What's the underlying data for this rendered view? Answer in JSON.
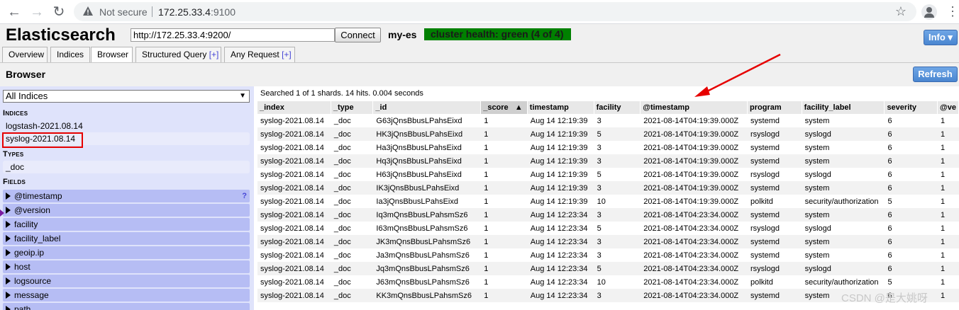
{
  "browser": {
    "not_secure": "Not secure",
    "url_host": "172.25.33.4",
    "url_port": ":9100"
  },
  "header": {
    "app_title": "Elasticsearch",
    "connect_url": "http://172.25.33.4:9200/",
    "connect_label": "Connect",
    "cluster_name": "my-es",
    "cluster_health": "cluster health: green (4 of 4)",
    "info_label": "Info ▾"
  },
  "tabs": [
    {
      "label": "Overview"
    },
    {
      "label": "Indices"
    },
    {
      "label": "Browser"
    },
    {
      "label": "Structured Query",
      "plus": "[+]"
    },
    {
      "label": "Any Request",
      "plus": "[+]"
    }
  ],
  "browser_bar": {
    "title": "Browser",
    "refresh_label": "Refresh"
  },
  "sidebar": {
    "index_select": "All Indices",
    "indices_title": "Indices",
    "indices": [
      "logstash-2021.08.14",
      "syslog-2021.08.14"
    ],
    "types_title": "Types",
    "types": [
      "_doc"
    ],
    "fields_title": "Fields",
    "fields": [
      "@timestamp",
      "@version",
      "facility",
      "facility_label",
      "geoip.ip",
      "host",
      "logsource",
      "message",
      "path"
    ],
    "field_help": "?"
  },
  "results": {
    "summary": "Searched 1 of 1 shards. 14 hits. 0.004 seconds",
    "columns": [
      "_index",
      "_type",
      "_id",
      "_score",
      "timestamp",
      "facility",
      "@timestamp",
      "program",
      "facility_label",
      "severity",
      "@ve"
    ],
    "sort_indicator": "▲",
    "rows": [
      [
        "syslog-2021.08.14",
        "_doc",
        "G63jQnsBbusLPahsEixd",
        "1",
        "Aug 14 12:19:39",
        "3",
        "2021-08-14T04:19:39.000Z",
        "systemd",
        "system",
        "6",
        "1"
      ],
      [
        "syslog-2021.08.14",
        "_doc",
        "HK3jQnsBbusLPahsEixd",
        "1",
        "Aug 14 12:19:39",
        "5",
        "2021-08-14T04:19:39.000Z",
        "rsyslogd",
        "syslogd",
        "6",
        "1"
      ],
      [
        "syslog-2021.08.14",
        "_doc",
        "Ha3jQnsBbusLPahsEixd",
        "1",
        "Aug 14 12:19:39",
        "3",
        "2021-08-14T04:19:39.000Z",
        "systemd",
        "system",
        "6",
        "1"
      ],
      [
        "syslog-2021.08.14",
        "_doc",
        "Hq3jQnsBbusLPahsEixd",
        "1",
        "Aug 14 12:19:39",
        "3",
        "2021-08-14T04:19:39.000Z",
        "systemd",
        "system",
        "6",
        "1"
      ],
      [
        "syslog-2021.08.14",
        "_doc",
        "H63jQnsBbusLPahsEixd",
        "1",
        "Aug 14 12:19:39",
        "5",
        "2021-08-14T04:19:39.000Z",
        "rsyslogd",
        "syslogd",
        "6",
        "1"
      ],
      [
        "syslog-2021.08.14",
        "_doc",
        "IK3jQnsBbusLPahsEixd",
        "1",
        "Aug 14 12:19:39",
        "3",
        "2021-08-14T04:19:39.000Z",
        "systemd",
        "system",
        "6",
        "1"
      ],
      [
        "syslog-2021.08.14",
        "_doc",
        "Ia3jQnsBbusLPahsEixd",
        "1",
        "Aug 14 12:19:39",
        "10",
        "2021-08-14T04:19:39.000Z",
        "polkitd",
        "security/authorization",
        "5",
        "1"
      ],
      [
        "syslog-2021.08.14",
        "_doc",
        "Iq3mQnsBbusLPahsmSz6",
        "1",
        "Aug 14 12:23:34",
        "3",
        "2021-08-14T04:23:34.000Z",
        "systemd",
        "system",
        "6",
        "1"
      ],
      [
        "syslog-2021.08.14",
        "_doc",
        "I63mQnsBbusLPahsmSz6",
        "1",
        "Aug 14 12:23:34",
        "5",
        "2021-08-14T04:23:34.000Z",
        "rsyslogd",
        "syslogd",
        "6",
        "1"
      ],
      [
        "syslog-2021.08.14",
        "_doc",
        "JK3mQnsBbusLPahsmSz6",
        "1",
        "Aug 14 12:23:34",
        "3",
        "2021-08-14T04:23:34.000Z",
        "systemd",
        "system",
        "6",
        "1"
      ],
      [
        "syslog-2021.08.14",
        "_doc",
        "Ja3mQnsBbusLPahsmSz6",
        "1",
        "Aug 14 12:23:34",
        "3",
        "2021-08-14T04:23:34.000Z",
        "systemd",
        "system",
        "6",
        "1"
      ],
      [
        "syslog-2021.08.14",
        "_doc",
        "Jq3mQnsBbusLPahsmSz6",
        "1",
        "Aug 14 12:23:34",
        "5",
        "2021-08-14T04:23:34.000Z",
        "rsyslogd",
        "syslogd",
        "6",
        "1"
      ],
      [
        "syslog-2021.08.14",
        "_doc",
        "J63mQnsBbusLPahsmSz6",
        "1",
        "Aug 14 12:23:34",
        "10",
        "2021-08-14T04:23:34.000Z",
        "polkitd",
        "security/authorization",
        "5",
        "1"
      ],
      [
        "syslog-2021.08.14",
        "_doc",
        "KK3mQnsBbusLPahsmSz6",
        "1",
        "Aug 14 12:23:34",
        "3",
        "2021-08-14T04:23:34.000Z",
        "systemd",
        "system",
        "6",
        "1"
      ]
    ]
  },
  "watermark": "CSDN @是大姚呀",
  "colors": {
    "cluster_health_green": "#008000",
    "sidebar_bg": "#dfe3fb",
    "field_row_bg": "#b6bdf4",
    "button_blue": "#4a86d0",
    "annotation_red": "#e60000"
  },
  "icons": [
    "back-arrow-icon",
    "forward-arrow-icon",
    "reload-icon",
    "warning-icon",
    "star-icon",
    "account-icon",
    "menu-kebab-icon",
    "dropdown-arrow-icon",
    "expand-triangle-icon",
    "annotation-arrow-icon"
  ]
}
